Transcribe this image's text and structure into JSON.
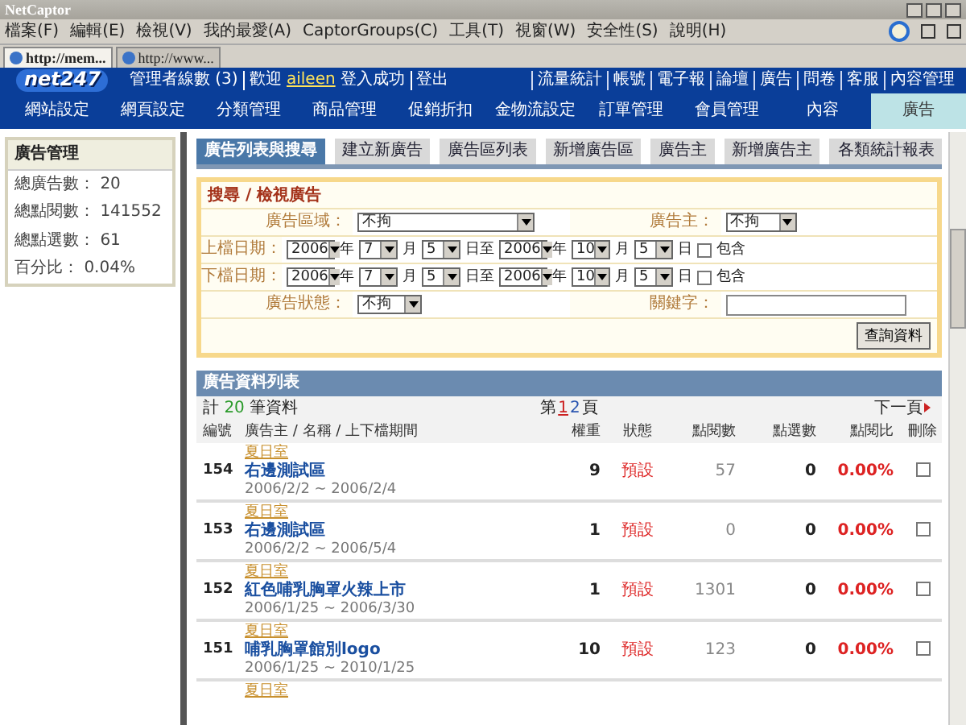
{
  "window": {
    "title": "NetCaptor"
  },
  "menu": [
    "檔案(F)",
    "編輯(E)",
    "檢視(V)",
    "我的最愛(A)",
    "CaptorGroups(C)",
    "工具(T)",
    "視窗(W)",
    "安全性(S)",
    "說明(H)"
  ],
  "browser_tabs": [
    {
      "label": "http://mem...",
      "selected": true
    },
    {
      "label": "http://www...",
      "selected": false
    }
  ],
  "header": {
    "logo": "net247",
    "admin_count": "管理者線數 (3)",
    "greeting": "歡迎",
    "user": "aileen",
    "login_status": "登入成功",
    "logout": "登出",
    "links": [
      "流量統計",
      "帳號",
      "電子報",
      "論壇",
      "廣告",
      "問卷",
      "客服",
      "內容管理"
    ]
  },
  "nav": [
    {
      "label": "網站設定",
      "selected": false
    },
    {
      "label": "網頁設定",
      "selected": false
    },
    {
      "label": "分類管理",
      "selected": false
    },
    {
      "label": "商品管理",
      "selected": false
    },
    {
      "label": "促銷折扣",
      "selected": false
    },
    {
      "label": "金物流設定",
      "selected": false
    },
    {
      "label": "訂單管理",
      "selected": false
    },
    {
      "label": "會員管理",
      "selected": false
    },
    {
      "label": "內容",
      "selected": false
    },
    {
      "label": "廣告",
      "selected": true
    }
  ],
  "sidebar": {
    "title": "廣告管理",
    "stats": [
      {
        "label": "總廣告數：",
        "value": "20"
      },
      {
        "label": "總點閱數：",
        "value": "141552"
      },
      {
        "label": "總點選數：",
        "value": "61"
      },
      {
        "label": "百分比：",
        "value": "0.04%"
      }
    ]
  },
  "sub_tabs": [
    {
      "label": "廣告列表與搜尋",
      "selected": true
    },
    {
      "label": "建立新廣告",
      "selected": false
    },
    {
      "label": "廣告區列表",
      "selected": false
    },
    {
      "label": "新增廣告區",
      "selected": false
    },
    {
      "label": "廣告主",
      "selected": false
    },
    {
      "label": "新增廣告主",
      "selected": false
    },
    {
      "label": "各類統計報表",
      "selected": false
    }
  ],
  "search": {
    "title": "搜尋 / 檢視廣告",
    "area": {
      "label": "廣告區域：",
      "value": "不拘"
    },
    "advertiser": {
      "label": "廣告主：",
      "value": "不拘"
    },
    "date_rows": [
      {
        "label": "上檔日期：",
        "from": [
          "2006",
          "7",
          "5"
        ],
        "to": [
          "2006",
          "10",
          "5"
        ],
        "units": [
          "年",
          "月",
          "日至",
          "年",
          "月",
          "日"
        ],
        "include_label": "包含",
        "include_checked": false
      },
      {
        "label": "下檔日期：",
        "from": [
          "2006",
          "7",
          "5"
        ],
        "to": [
          "2006",
          "10",
          "5"
        ],
        "units": [
          "年",
          "月",
          "日至",
          "年",
          "月",
          "日"
        ],
        "include_label": "包含",
        "include_checked": false
      }
    ],
    "status": {
      "label": "廣告狀態：",
      "value": "不拘"
    },
    "keyword": {
      "label": "關鍵字："
    },
    "submit": "查詢資料"
  },
  "list": {
    "title": "廣告資料列表",
    "count_prefix": "計",
    "count": "20",
    "count_suffix": "筆資料",
    "page_prefix": "第",
    "pages": [
      {
        "label": "1",
        "selected": true
      },
      {
        "label": "2",
        "selected": false
      }
    ],
    "page_suffix": "頁",
    "next": "下一頁",
    "columns": [
      "編號",
      "廣告主 / 名稱 / 上下檔期間",
      "權重",
      "狀態",
      "點閱數",
      "點選數",
      "點閱比",
      "刪除"
    ],
    "rows": [
      {
        "id": "154",
        "advertiser": "夏日室",
        "name": "右邊測試區",
        "period": "2006/2/2 ~ 2006/2/4",
        "weight": "9",
        "status": "預設",
        "views": "57",
        "clicks": "0",
        "ratio": "0.00%",
        "delete_checked": false
      },
      {
        "id": "153",
        "advertiser": "夏日室",
        "name": "右邊測試區",
        "period": "2006/2/2 ~ 2006/5/4",
        "weight": "1",
        "status": "預設",
        "views": "0",
        "clicks": "0",
        "ratio": "0.00%",
        "delete_checked": false
      },
      {
        "id": "152",
        "advertiser": "夏日室",
        "name": "紅色哺乳胸罩火辣上市",
        "period": "2006/1/25 ~ 2006/3/30",
        "weight": "1",
        "status": "預設",
        "views": "1301",
        "clicks": "0",
        "ratio": "0.00%",
        "delete_checked": false
      },
      {
        "id": "151",
        "advertiser": "夏日室",
        "name": "哺乳胸罩館別logo",
        "period": "2006/1/25 ~ 2010/1/25",
        "weight": "10",
        "status": "預設",
        "views": "123",
        "clicks": "0",
        "ratio": "0.00%",
        "delete_checked": false
      }
    ],
    "partial_row": {
      "advertiser": "夏日室"
    }
  }
}
